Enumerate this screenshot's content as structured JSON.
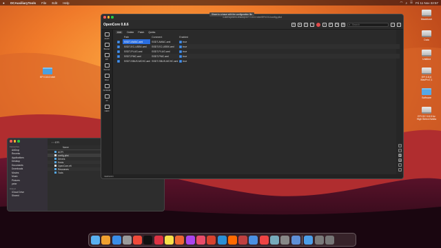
{
  "menubar": {
    "app": "OCAuxiliaryTools",
    "items": [
      "File",
      "Edit",
      "Help"
    ],
    "clock": "Fri 11 Nov  22:57"
  },
  "desktop_icons": [
    {
      "label": "Macintosh",
      "type": "drive"
    },
    {
      "label": "Data",
      "type": "drive"
    },
    {
      "label": "Untitled",
      "type": "drive"
    },
    {
      "label": "EFI 0.8.6 MacPro7,1",
      "type": "drive"
    },
    {
      "label": "Software",
      "type": "folder"
    },
    {
      "label": "EFI OC 0.8.5 for High Sierra Nvidia",
      "type": "drive"
    },
    {
      "label": "EFI 0.8.6 Intel",
      "type": "folder"
    }
  ],
  "window": {
    "title": "/Users/peter/Desktop/EFI 0.8.6 Intel/EFI/OC/config.plist",
    "app_name": "OpenCore 0.8.6",
    "search_placeholder": "Search",
    "tooltip": "Share to a issue with the configuration file",
    "sidebar": [
      "ACPI",
      "Booter",
      "DP",
      "Kernel",
      "Misc",
      "NVRAM",
      "PI",
      "UEFI"
    ],
    "tabs": [
      "Add",
      "Delete",
      "Patch",
      "Quirks"
    ],
    "columns": [
      "",
      "Path",
      "Comment",
      "Enabled"
    ],
    "rows": [
      {
        "path": "SSDT-AWAC.aml",
        "comment": "SSDT-AWAC.aml",
        "enabled": "true"
      },
      {
        "path": "SSDT-EC-USBX.aml",
        "comment": "SSDT-EC-USBX.aml",
        "enabled": "true"
      },
      {
        "path": "SSDT-PLUG.aml",
        "comment": "SSDT-PLUG.aml",
        "enabled": "true"
      },
      {
        "path": "SSDT-PMC.aml",
        "comment": "SSDT-PMC.aml",
        "enabled": "true"
      },
      {
        "path": "SSDT-SBUS-MCHC.aml",
        "comment": "SSDT-SBUS-MCHC.aml",
        "enabled": "true"
      }
    ],
    "status": "VERSION"
  },
  "finder": {
    "sidebar_sections": [
      {
        "title": "Favourites",
        "items": [
          "AirDrop",
          "Recents",
          "Applications",
          "Desktop",
          "Documents",
          "Downloads",
          "Movies",
          "Music",
          "Pictures",
          "peter"
        ]
      },
      {
        "title": "iCloud",
        "items": [
          "iCloud Drive",
          "Shared"
        ]
      }
    ],
    "path_label": "EFI",
    "column_header": "Name",
    "files": [
      {
        "name": "ACPI",
        "type": "folder"
      },
      {
        "name": "config.plist",
        "type": "doc",
        "selected": true
      },
      {
        "name": "Drivers",
        "type": "folder"
      },
      {
        "name": "Kexts",
        "type": "folder"
      },
      {
        "name": "OpenCore.efi",
        "type": "doc"
      },
      {
        "name": "Resources",
        "type": "folder"
      },
      {
        "name": "Tools",
        "type": "folder"
      }
    ]
  },
  "dock": {
    "colors": [
      "#5ab0f0",
      "#f0a030",
      "#3a8ee8",
      "#9a9a9a",
      "#f04a3a",
      "#111",
      "#dd3344",
      "#f7e04a",
      "#e63",
      "#aa44ee",
      "#e84c6a",
      "#d8422e",
      "#2a8fd6",
      "#ff6a00",
      "#c04040",
      "#4a90e2",
      "#e44",
      "#7ab",
      "#888",
      "#5f8fd6",
      "#4c9ee8",
      "#7a7a7a",
      "#777"
    ]
  }
}
